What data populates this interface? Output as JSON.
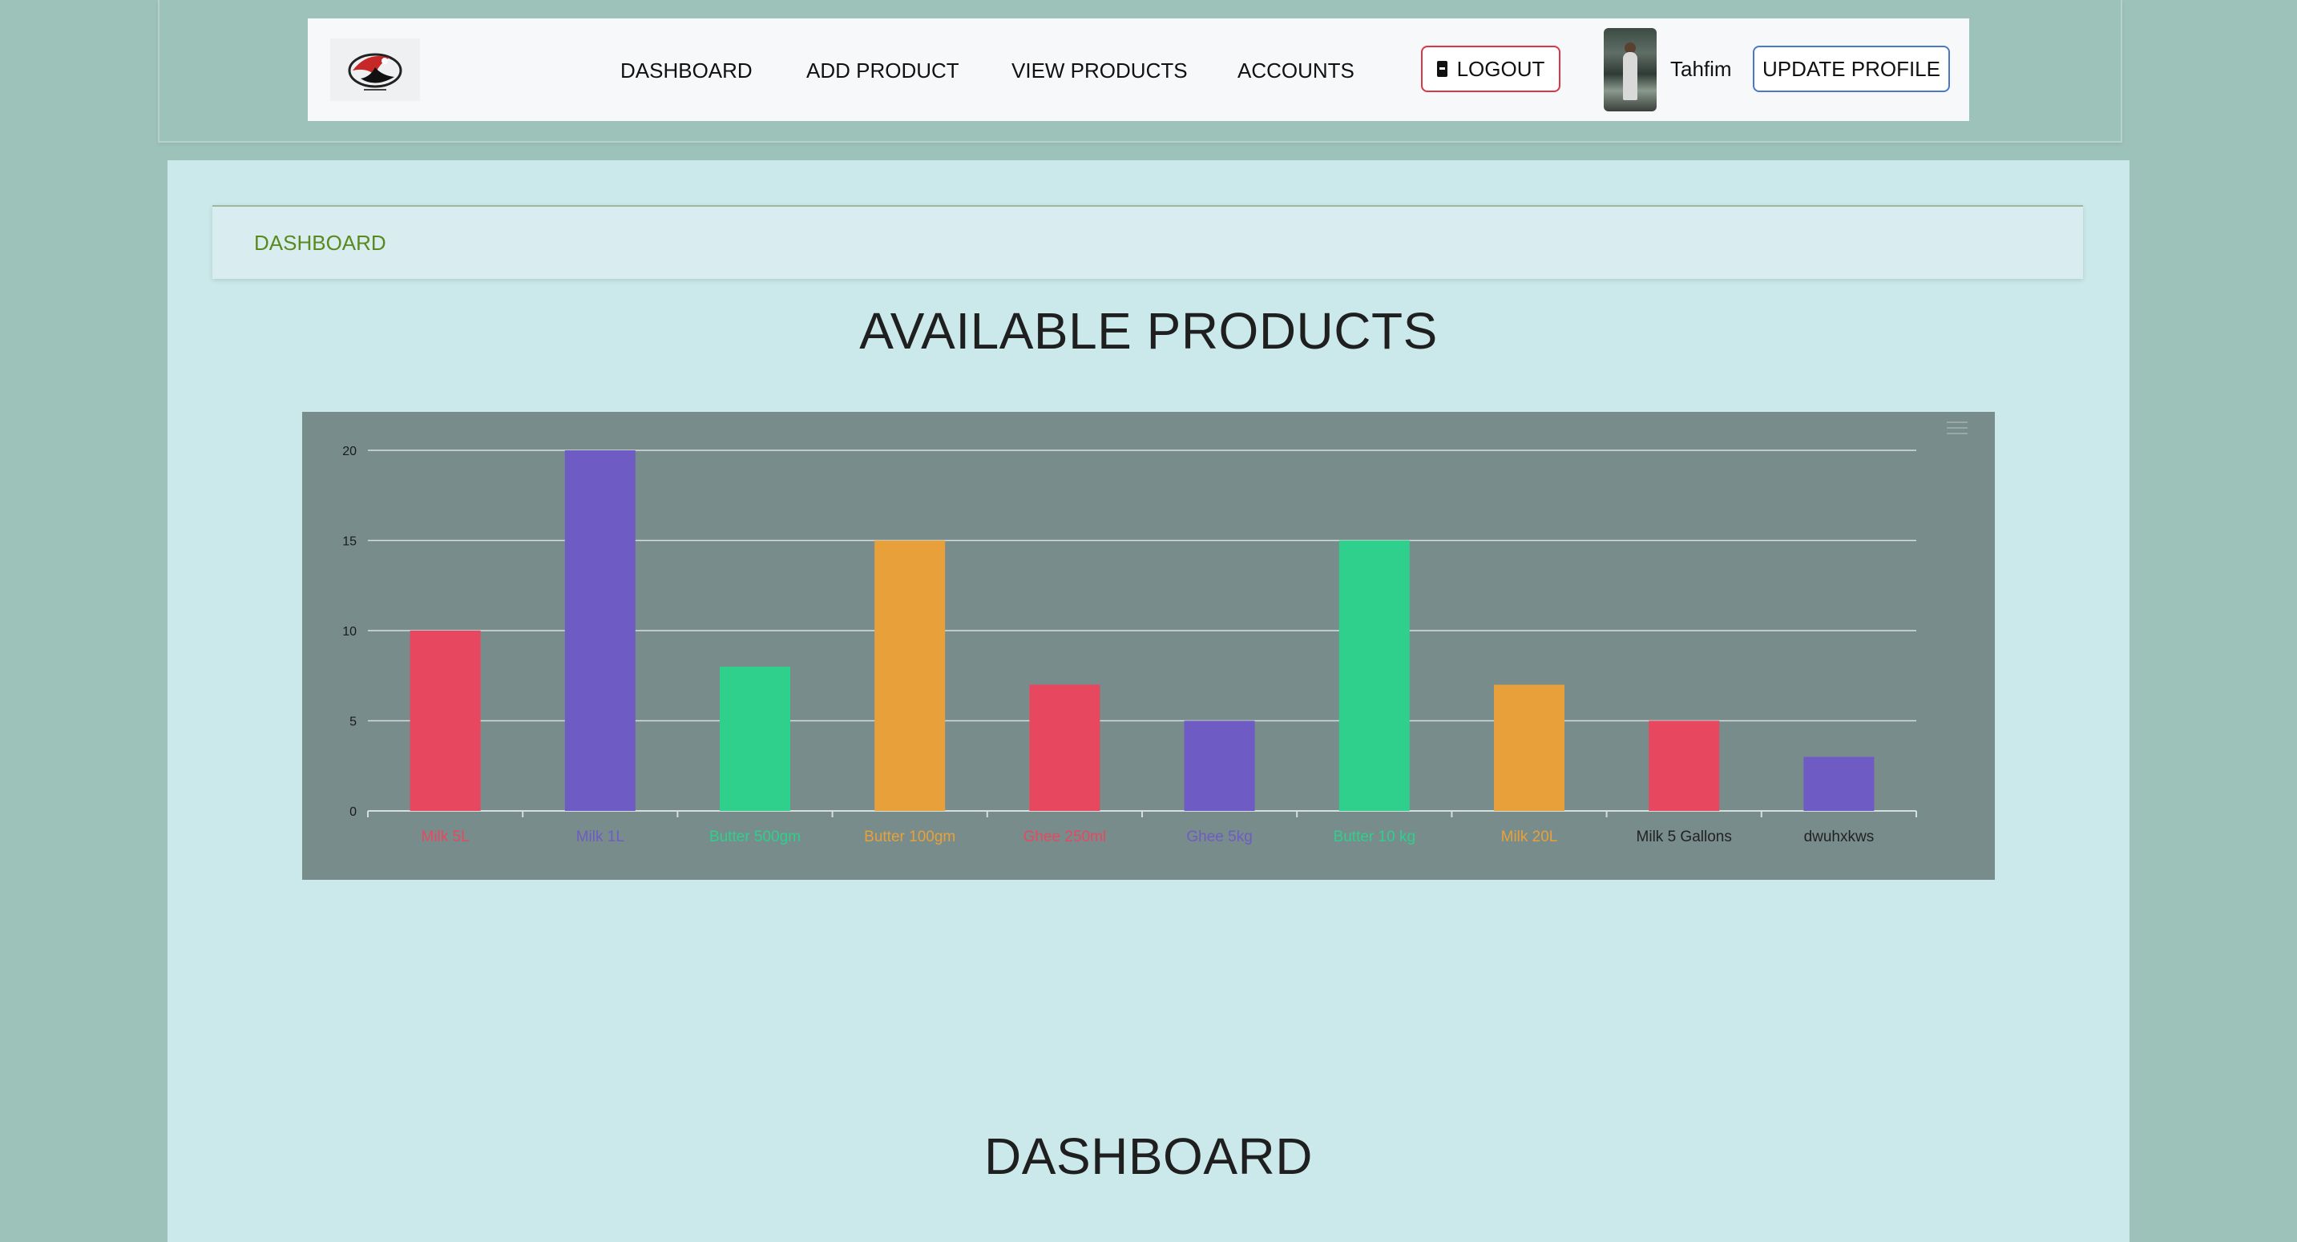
{
  "navbar": {
    "logo_alt": "brand-logo",
    "links": [
      "DASHBOARD",
      "ADD PRODUCT",
      "VIEW PRODUCTS",
      "ACCOUNTS"
    ],
    "logout_label": "LOGOUT",
    "username": "Tahfim",
    "update_profile_label": "UPDATE PROFILE"
  },
  "breadcrumb": {
    "label": "DASHBOARD"
  },
  "main": {
    "products_title": "AVAILABLE PRODUCTS",
    "dashboard_title": "DASHBOARD"
  },
  "chart_data": {
    "type": "bar",
    "title": "",
    "xlabel": "",
    "ylabel": "",
    "ylim": [
      0,
      20
    ],
    "yticks": [
      0,
      5,
      10,
      15,
      20
    ],
    "grid": true,
    "categories": [
      "Milk 5L",
      "Milk 1L",
      "Butter 500gm",
      "Butter 100gm",
      "Ghee 250ml",
      "Ghee 5kg",
      "Butter 10 kg",
      "Milk 20L",
      "Milk 5 Gallons",
      "dwuhxkws"
    ],
    "values": [
      10,
      20,
      8,
      15,
      7,
      5,
      15,
      7,
      5,
      3
    ],
    "colors": [
      "#e8485f",
      "#6f5bc4",
      "#2ed08c",
      "#e8a13a",
      "#e8485f",
      "#6f5bc4",
      "#2ed08c",
      "#e8a13a",
      "#e8485f",
      "#6f5bc4"
    ],
    "label_colors": [
      "#e8485f",
      "#6f5bc4",
      "#2ed08c",
      "#e8a13a",
      "#e8485f",
      "#6f5bc4",
      "#2ed08c",
      "#e8a13a",
      "#222222",
      "#222222"
    ]
  }
}
